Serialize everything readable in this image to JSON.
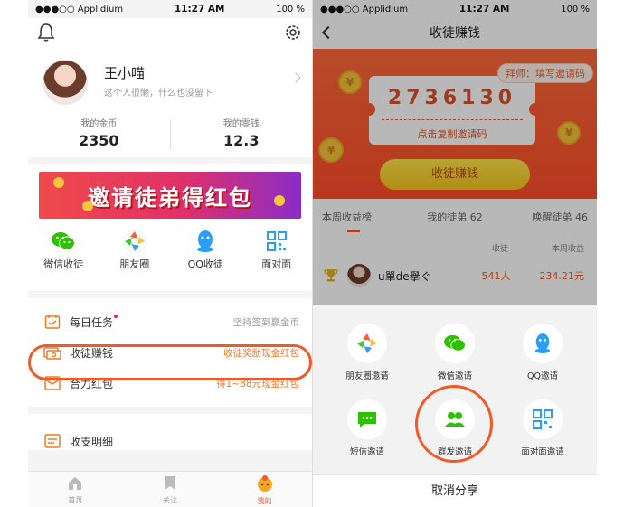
{
  "left": {
    "status": {
      "carrier": "●●●○○ Applidium",
      "time": "11:27 AM",
      "battery": "100 %"
    },
    "profile": {
      "name": "王小喵",
      "desc": "这个人很懒，什么也没留下"
    },
    "stats": [
      {
        "label": "我的金币",
        "value": "2350"
      },
      {
        "label": "我的零钱",
        "value": "12.3"
      }
    ],
    "banner": "邀请徒弟得红包",
    "shares": [
      {
        "label": "微信收徒",
        "icon": "wechat-icon"
      },
      {
        "label": "朋友圈",
        "icon": "moments-icon"
      },
      {
        "label": "QQ收徒",
        "icon": "qq-icon"
      },
      {
        "label": "面对面",
        "icon": "qrcode-icon"
      }
    ],
    "menu": [
      {
        "title": "每日任务",
        "right": "坚持签到赢金币"
      },
      {
        "title": "收徒赚钱",
        "right": "收徒奖励现金红包"
      },
      {
        "title": "合力红包",
        "right": "得1~88元现金红包"
      }
    ],
    "menu2": {
      "title": "收支明细"
    },
    "tabs": [
      {
        "label": "首页"
      },
      {
        "label": "关注"
      },
      {
        "label": "我的"
      }
    ],
    "colors": {
      "accent": "#f05a28"
    }
  },
  "right": {
    "status": {
      "carrier": "●●●○○ Applidium",
      "time": "11:27 AM",
      "battery": "100 %"
    },
    "title": "收徒赚钱",
    "ribbon": "拜师：填写邀请码",
    "code": "2736130",
    "code_hint": "点击复制邀请码",
    "cta": "收徒赚钱",
    "tabs": [
      "本周收益榜",
      "我的徒弟 62",
      "唤醒徒弟 46"
    ],
    "board": {
      "headers": [
        "收徒",
        "本周收益"
      ],
      "rows": [
        {
          "name": "u單de擧ぐ",
          "count": "541人",
          "income": "234.21元"
        }
      ]
    },
    "share_sheet": {
      "items": [
        {
          "label": "朋友圈邀请",
          "icon": "moments-icon"
        },
        {
          "label": "微信邀请",
          "icon": "wechat-icon"
        },
        {
          "label": "QQ邀请",
          "icon": "qq-icon"
        },
        {
          "label": "短信邀请",
          "icon": "sms-icon"
        },
        {
          "label": "群发邀请",
          "icon": "group-icon"
        },
        {
          "label": "面对面邀请",
          "icon": "qrcode-icon"
        }
      ],
      "cancel": "取消分享"
    }
  }
}
